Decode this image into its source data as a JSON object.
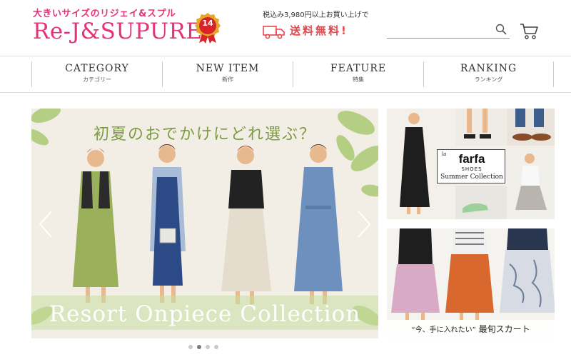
{
  "header": {
    "tagline": "大きいサイズのリジェイ&スプル",
    "brand": "Re-J&SUPURE",
    "anniversary": "14",
    "shipping_note": "税込み3,980円以上お買い上げで",
    "shipping_main": "送料無料!",
    "search_placeholder": ""
  },
  "nav": [
    {
      "label": "CATEGORY",
      "sub": "カテゴリー"
    },
    {
      "label": "NEW ITEM",
      "sub": "新作"
    },
    {
      "label": "FEATURE",
      "sub": "特集"
    },
    {
      "label": "RANKING",
      "sub": "ランキング"
    }
  ],
  "main_banner": {
    "headline": "初夏のおでかけにどれ選ぶ？",
    "caption": "Resort Onpiece Collection",
    "slide_count": 4,
    "active_slide": 2
  },
  "side_banners": {
    "shoes": {
      "brand_prefix": "la",
      "brand": "farfa",
      "line": "SHOES",
      "collection": "Summer Collection"
    },
    "skirt": {
      "quote": "“今、手に入れたい”",
      "title": "最旬スカート"
    }
  },
  "colors": {
    "brand_pink": "#e5337a",
    "shipping_red": "#e8454d",
    "banner_green": "#7d9a45"
  }
}
